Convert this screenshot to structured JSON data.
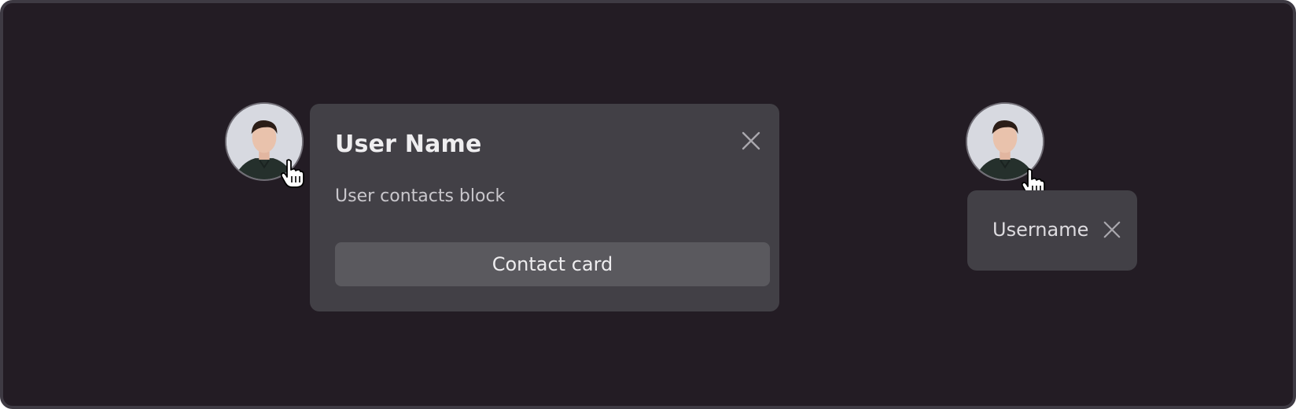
{
  "popup": {
    "title": "User Name",
    "description": "User contacts block",
    "button_label": "Contact card"
  },
  "tooltip": {
    "label": "Username"
  },
  "icons": {
    "avatar": "user-avatar-photo",
    "cursor": "hand-pointer-cursor",
    "close": "close-x-icon"
  },
  "colors": {
    "background": "#231c24",
    "popup": "#424046",
    "button": "#5a595e"
  }
}
